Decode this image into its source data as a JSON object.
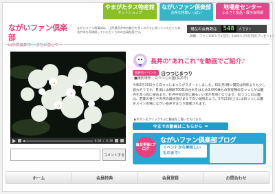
{
  "tabs": [
    {
      "title": "やまがたタス物産館",
      "sub": "ネットショップ",
      "color": "#8bbf26"
    },
    {
      "title": "ながいファン倶楽部",
      "sub": "お得な特典いっぱい",
      "color": "#36b7c9"
    },
    {
      "title": "地場産センター",
      "sub": "ふるさと産品・展示会情報",
      "color": "#e6478b"
    }
  ],
  "header": {
    "title": "ながいファン倶楽部",
    "subtitle": "山形県長井市 ～まちに恋して～",
    "description": "ながいファン倶楽部は、山形県長井市の魅力を多くの方々に知っていただくため、長井市を再確認していただくための会員制度です。"
  },
  "members": {
    "label": "現在の会員数は",
    "count": "548",
    "unit": "人です♪",
    "note": "目標：ファン100人で3万円、1000人で5万円のプレゼント!"
  },
  "video": {
    "time": "0:00 / 0:30",
    "progress": 0.02,
    "comment_placeholder": "",
    "comment_button": "コメントする"
  },
  "feature": {
    "title": "長井の\"あれこれ\"を動画でご紹介♪",
    "badge": "長井のイベント",
    "event_name": "白つつじまつり",
    "place": "■撮影場所：白つつじ公園(長井市)",
    "body": "今年6月10日から白つつじまつりがスタートしました。6日(月)時に開花は例年よりも少し遅れそうです。見頃には樹齢700年の古木をはじめ3,000株もの現役種の白つつじが公園内を真っ白に染めます。牡丹中旬の頃に最もいい頃が見頃となります。白つつじの公園は、若葉の香りや天然の森林浴がまるで白い絨毯のよう。5月21日(土)には白つつじ公園をメイン会場にながい長井すまつり開催されます。",
    "note": "▶ボタンをクリックすると動画をご覧いただけます。",
    "list_button": "今までの動画はこちらから"
  },
  "blog": {
    "circle": "毎日更新!ブログ",
    "title": "ながいファン倶楽部ブログ",
    "sub": "イベントから美味しいものまで!"
  },
  "nav": [
    {
      "label": "ホーム"
    },
    {
      "label": "会員特典"
    },
    {
      "label": "会員登録"
    },
    {
      "label": "お問合わせ"
    }
  ]
}
